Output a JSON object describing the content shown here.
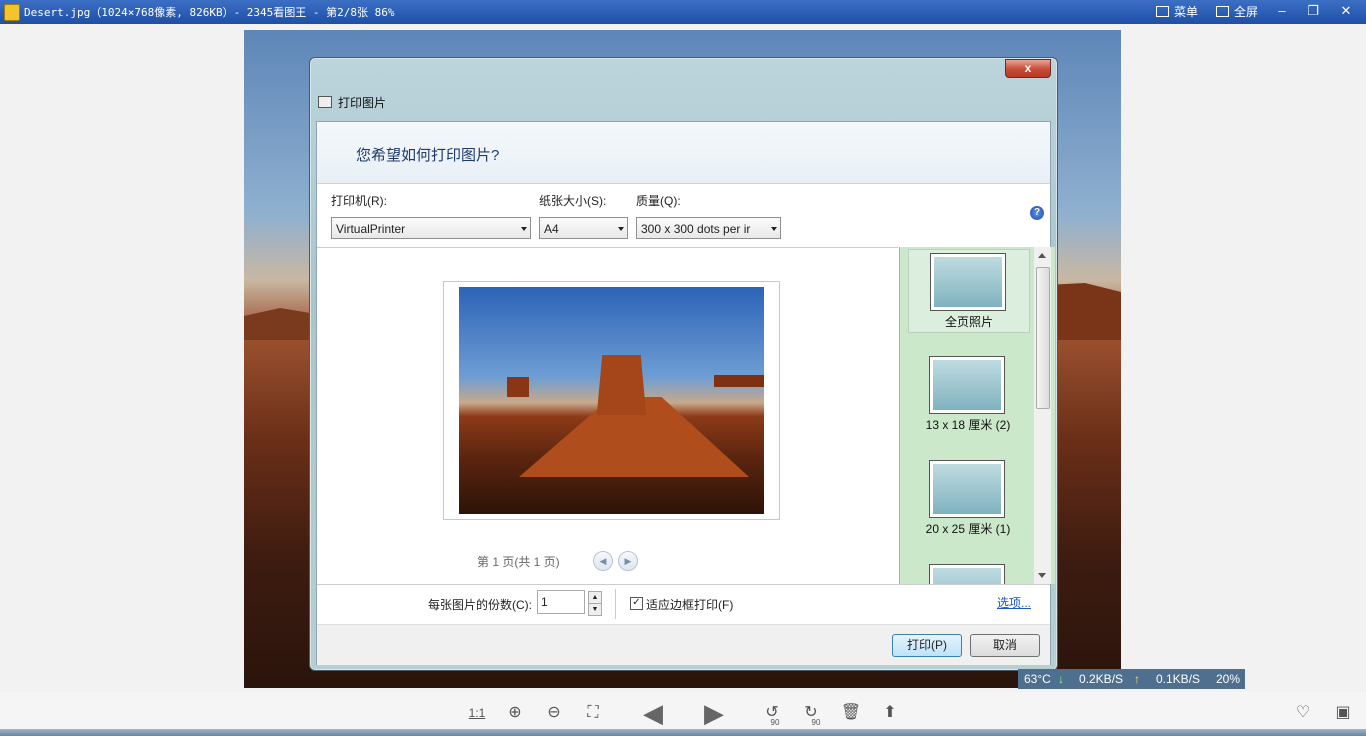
{
  "viewer": {
    "title": "Desert.jpg（1024×768像素, 826KB）- 2345看图王 - 第2/8张 86%",
    "menu_label": "菜单",
    "fullscreen_label": "全屏"
  },
  "dialog": {
    "title": "打印图片",
    "close": "x",
    "question": "您希望如何打印图片?",
    "printer_label": "打印机(R):",
    "printer_value": "VirtualPrinter",
    "paper_label": "纸张大小(S):",
    "paper_value": "A4",
    "quality_label": "质量(Q):",
    "quality_value": "300 x 300 dots per ir",
    "help": "?",
    "page_info": "第 1 页(共 1 页)",
    "layouts": [
      {
        "label": "全页照片"
      },
      {
        "label": "13 x 18 厘米 (2)"
      },
      {
        "label": "20 x 25 厘米 (1)"
      }
    ],
    "copies_label": "每张图片的份数(C):",
    "copies_value": "1",
    "fit_label": "适应边框打印(F)",
    "fit_checked": "✓",
    "options_link": "选项...",
    "print_button": "打印(P)",
    "cancel_button": "取消"
  },
  "status": {
    "temp": "63°C",
    "down": "0.2KB/S",
    "up": "0.1KB/S",
    "cpu": "20%"
  },
  "toolbar": {
    "actual_size": "1:1",
    "rotate_left_deg": "90",
    "rotate_right_deg": "90"
  },
  "colors": {
    "titlebar": "#2a5cb5",
    "layout_panel": "#cbe8cb",
    "link": "#1a55c2"
  }
}
